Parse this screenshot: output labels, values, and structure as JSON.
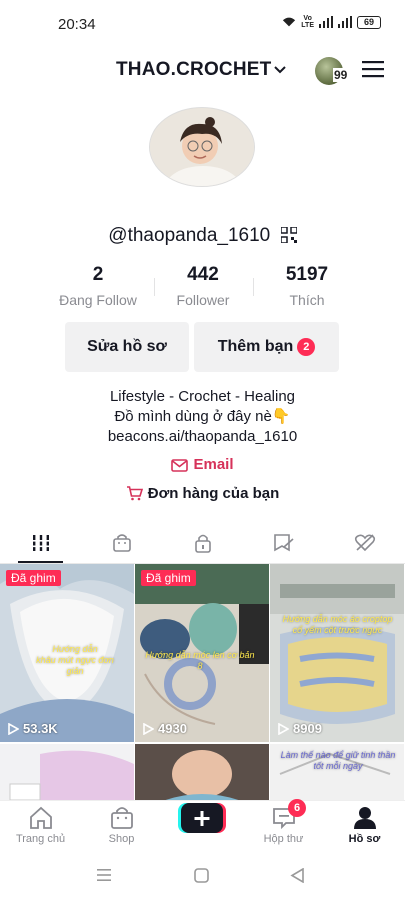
{
  "status_bar": {
    "time": "20:34",
    "volte": "Vo\nLTE",
    "battery": "69"
  },
  "header": {
    "username": "THAO.CROCHET",
    "notification_count": "99"
  },
  "profile": {
    "handle": "@thaopanda_1610"
  },
  "stats": [
    {
      "value": "2",
      "label": "Đang Follow"
    },
    {
      "value": "442",
      "label": "Follower"
    },
    {
      "value": "5197",
      "label": "Thích"
    }
  ],
  "buttons": {
    "edit_profile": "Sửa hồ sơ",
    "add_friends": "Thêm bạn",
    "add_friends_badge": "2"
  },
  "bio": {
    "line1": "Lifestyle - Crochet - Healing",
    "line2": "Đồ mình dùng ở đây nè👇",
    "link": "beacons.ai/thaopanda_1610"
  },
  "email_label": "Email",
  "orders_label": "Đơn hàng của bạn",
  "tabs": [
    {
      "icon": "grid-icon",
      "active": true
    },
    {
      "icon": "shop-bag-icon"
    },
    {
      "icon": "lock-icon"
    },
    {
      "icon": "tagged-icon"
    },
    {
      "icon": "liked-hidden-icon"
    }
  ],
  "videos": [
    {
      "pinned": "Đã ghim",
      "views": "53.3K",
      "caption": "Hướng dẫn\nkhâu mút ngực đơn giản"
    },
    {
      "pinned": "Đã ghim",
      "views": "4930",
      "caption": "Hướng dẫn móc len cơ bản 8"
    },
    {
      "views": "8909",
      "caption": "Hướng dẫn móc áo croptop\ncổ yếm cột trước ngực"
    },
    {},
    {},
    {
      "caption": "Làm thế nào để giữ tinh thần tốt mỗi ngày"
    }
  ],
  "bottom_nav": [
    {
      "label": "Trang chủ",
      "icon": "home-icon"
    },
    {
      "label": "Shop",
      "icon": "shop-icon"
    },
    {
      "label": "",
      "icon": "plus-icon"
    },
    {
      "label": "Hộp thư",
      "icon": "inbox-icon",
      "badge": "6"
    },
    {
      "label": "Hồ sơ",
      "icon": "profile-icon",
      "active": true
    }
  ],
  "colors": {
    "accent": "#fe2c55",
    "email": "#d6325a",
    "text": "#161823",
    "muted": "#8a8b91"
  }
}
